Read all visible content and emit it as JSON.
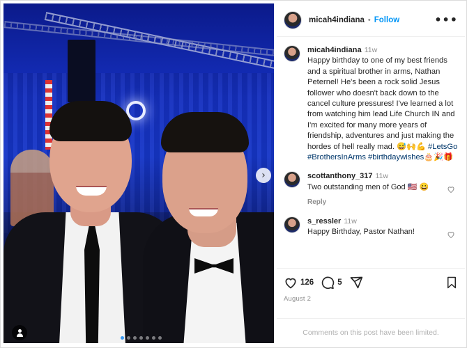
{
  "post": {
    "username": "micah4indiana",
    "follow_label": "Follow",
    "separator": "•",
    "more_label": "•••"
  },
  "caption": {
    "username": "micah4indiana",
    "age": "11w",
    "text": "Happy birthday to one of my best friends and a spiritual brother in arms, Nathan Peternel! He's been a rock solid Jesus follower who doesn't back down to the cancel culture pressures! I've learned a lot from watching him lead Life Church IN and I'm excited for many more years of friendship, adventures and just making the hordes of hell really mad. 😅🙌💪",
    "hashtags": "#LetsGo #BrothersInArms #birthdaywishes",
    "trailing_emoji": "🎂🎉🎁"
  },
  "comments": [
    {
      "username": "scottanthony_317",
      "age": "11w",
      "text": "Two outstanding men of God 🇺🇸 😀",
      "reply_label": "Reply"
    },
    {
      "username": "s_ressler",
      "age": "11w",
      "text": "Happy Birthday, Pastor Nathan!"
    }
  ],
  "stats": {
    "likes": "126",
    "comments": "5"
  },
  "date": "August 2",
  "limited_notice": "Comments on this post have been limited.",
  "photo": {
    "next_icon": "›",
    "carousel_count": 7,
    "active_index": 1
  },
  "colors": {
    "accent": "#0095f6",
    "hashtag": "#00376b",
    "muted": "#8e8e8e",
    "stage_blue": "#1636c8"
  },
  "icons": [
    "more-icon",
    "heart-icon",
    "comment-icon",
    "share-icon",
    "bookmark-icon",
    "next-arrow-icon",
    "user-tag-icon"
  ]
}
